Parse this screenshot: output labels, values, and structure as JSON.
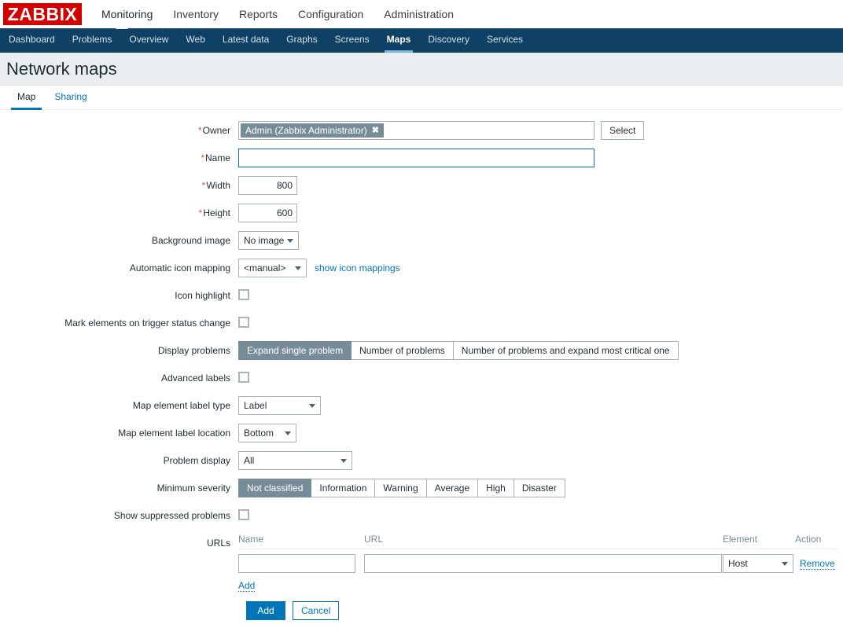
{
  "brand": {
    "logo_text": "ZABBIX",
    "logo_color": "#d40000"
  },
  "main_menu": {
    "items": [
      {
        "label": "Monitoring",
        "selected": true
      },
      {
        "label": "Inventory",
        "selected": false
      },
      {
        "label": "Reports",
        "selected": false
      },
      {
        "label": "Configuration",
        "selected": false
      },
      {
        "label": "Administration",
        "selected": false
      }
    ]
  },
  "sub_menu": {
    "items": [
      {
        "label": "Dashboard",
        "selected": false
      },
      {
        "label": "Problems",
        "selected": false
      },
      {
        "label": "Overview",
        "selected": false
      },
      {
        "label": "Web",
        "selected": false
      },
      {
        "label": "Latest data",
        "selected": false
      },
      {
        "label": "Graphs",
        "selected": false
      },
      {
        "label": "Screens",
        "selected": false
      },
      {
        "label": "Maps",
        "selected": true
      },
      {
        "label": "Discovery",
        "selected": false
      },
      {
        "label": "Services",
        "selected": false
      }
    ]
  },
  "page": {
    "title": "Network maps"
  },
  "form_tabs": {
    "items": [
      {
        "label": "Map",
        "selected": true
      },
      {
        "label": "Sharing",
        "selected": false
      }
    ]
  },
  "form": {
    "owner": {
      "label": "Owner",
      "required": "*",
      "chip_text": "Admin (Zabbix Administrator)",
      "chip_remove_icon": "✖",
      "select_button": "Select"
    },
    "name": {
      "label": "Name",
      "required": "*",
      "value": "",
      "placeholder": ""
    },
    "width": {
      "label": "Width",
      "required": "*",
      "value": "800"
    },
    "height": {
      "label": "Height",
      "required": "*",
      "value": "600"
    },
    "background_image": {
      "label": "Background image",
      "value": "No image",
      "options": [
        "No image"
      ]
    },
    "automatic_icon_mapping": {
      "label": "Automatic icon mapping",
      "value": "<manual>",
      "options": [
        "<manual>"
      ],
      "link": "show icon mappings"
    },
    "icon_highlight": {
      "label": "Icon highlight",
      "checked": false
    },
    "mark_elements": {
      "label": "Mark elements on trigger status change",
      "checked": false
    },
    "display_problems": {
      "label": "Display problems",
      "options": [
        "Expand single problem",
        "Number of problems",
        "Number of problems and expand most critical one"
      ],
      "selected_index": 0
    },
    "advanced_labels": {
      "label": "Advanced labels",
      "checked": false
    },
    "map_element_label_type": {
      "label": "Map element label type",
      "value": "Label",
      "options": [
        "Label"
      ]
    },
    "map_element_label_location": {
      "label": "Map element label location",
      "value": "Bottom",
      "options": [
        "Bottom"
      ]
    },
    "problem_display": {
      "label": "Problem display",
      "value": "All",
      "options": [
        "All"
      ]
    },
    "minimum_severity": {
      "label": "Minimum severity",
      "options": [
        "Not classified",
        "Information",
        "Warning",
        "Average",
        "High",
        "Disaster"
      ],
      "selected_index": 0
    },
    "show_suppressed": {
      "label": "Show suppressed problems",
      "checked": false
    },
    "urls": {
      "label": "URLs",
      "columns": {
        "name": "Name",
        "url": "URL",
        "element": "Element",
        "action": "Action"
      },
      "rows": [
        {
          "name": "",
          "url": "",
          "element": "Host",
          "action": "Remove"
        }
      ],
      "add_link": "Add"
    }
  },
  "footer": {
    "submit": "Add",
    "cancel": "Cancel"
  }
}
